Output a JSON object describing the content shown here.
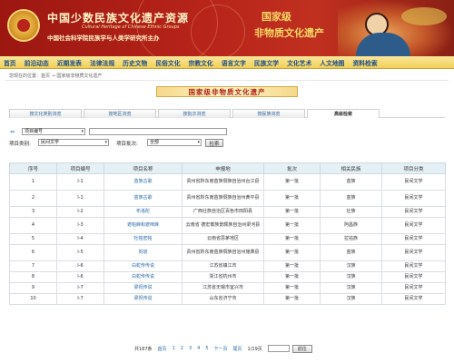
{
  "header": {
    "title": "中国少数民族文化遗产资源",
    "subtitle_en": "Cultural Heritage of Chinese Ethnic Groups",
    "subtitle_cn": "中国社会科学院民族学与人类学研究所主办",
    "stamp_line1": "国家级",
    "stamp_line2": "非物质文化遗产"
  },
  "nav": {
    "items": [
      "首页",
      "前沿动态",
      "近期发表",
      "法律法规",
      "历史文物",
      "民俗文化",
      "宗教文化",
      "语言文字",
      "民族文学",
      "文化艺术",
      "人文地图",
      "资料检索"
    ]
  },
  "breadcrumb": "您现在的位置：首页 → 国家级非物质文化遗产",
  "section_banner": "国家级非物质文化遗产",
  "tabs": [
    {
      "label": "按文化类别浏览",
      "active": false
    },
    {
      "label": "按地区浏览",
      "active": false
    },
    {
      "label": "按批次浏览",
      "active": false
    },
    {
      "label": "按民族浏览",
      "active": false
    },
    {
      "label": "高级检索",
      "active": true
    }
  ],
  "search": {
    "field_select": "项目编号",
    "category_label": "项目类别:",
    "category_value": "民间文学",
    "batch_label": "项目批次:",
    "batch_value": "全部",
    "button": "检索"
  },
  "table": {
    "headers": [
      "序号",
      "项目编号",
      "项目名称",
      "申报地",
      "批次",
      "相关民族",
      "项目分类"
    ],
    "rows": [
      {
        "no": "1",
        "code": "Ⅰ-1",
        "name": "苗族古歌",
        "place": "贵州省黔东南苗族侗族自治州台江县",
        "batch": "第一批",
        "ethnic": "苗族",
        "cat": "民间文学",
        "tall": true
      },
      {
        "no": "2",
        "code": "Ⅰ-1",
        "name": "苗族古歌",
        "place": "贵州省黔东南苗族侗族自治州黄平县",
        "batch": "第一批",
        "ethnic": "苗族",
        "cat": "民间文学",
        "tall": true
      },
      {
        "no": "3",
        "code": "Ⅰ-2",
        "name": "布洛陀",
        "place": "广西壮族自治区百色市田阳县",
        "batch": "第一批",
        "ethnic": "壮族",
        "cat": "民间文学",
        "tall": false
      },
      {
        "no": "4",
        "code": "Ⅰ-3",
        "name": "遮帕麻和遮咪麻",
        "place": "云南省 德宏傣族景颇族自治州梁河县",
        "batch": "第一批",
        "ethnic": "阿昌族",
        "cat": "民间文学",
        "tall": true
      },
      {
        "no": "5",
        "code": "Ⅰ-4",
        "name": "牡帕密帕",
        "place": "云南省思茅地区",
        "batch": "第一批",
        "ethnic": "拉祜族",
        "cat": "民间文学",
        "tall": false
      },
      {
        "no": "6",
        "code": "Ⅰ-5",
        "name": "刻道",
        "place": "贵州省黔东南苗族侗族自治州施秉县",
        "batch": "第一批",
        "ethnic": "苗族",
        "cat": "民间文学",
        "tall": true
      },
      {
        "no": "7",
        "code": "Ⅰ-6",
        "name": "白蛇传传说",
        "place": "江苏省镇江市",
        "batch": "第一批",
        "ethnic": "汉族",
        "cat": "民间文学",
        "tall": false
      },
      {
        "no": "8",
        "code": "Ⅰ-6",
        "name": "白蛇传传说",
        "place": "浙江省杭州市",
        "batch": "第一批",
        "ethnic": "汉族",
        "cat": "民间文学",
        "tall": false
      },
      {
        "no": "9",
        "code": "Ⅰ-7",
        "name": "梁祝传说",
        "place": "江苏省无锡市宜兴市",
        "batch": "第一批",
        "ethnic": "汉族",
        "cat": "民间文学",
        "tall": false
      },
      {
        "no": "10",
        "code": "Ⅰ-7",
        "name": "梁祝传说",
        "place": "山东省济宁市",
        "batch": "第一批",
        "ethnic": "汉族",
        "cat": "民间文学",
        "tall": false
      }
    ]
  },
  "pager": {
    "total": "共187条",
    "first": "首页",
    "pages": [
      "1",
      "2",
      "3",
      "4",
      "5"
    ],
    "next": "下一页",
    "last": "尾页",
    "page_info": "1/19页",
    "go": "前往"
  },
  "colors": {
    "banner": "#b7241a",
    "nav": "#f1cf58",
    "link": "#2a6aa8"
  }
}
